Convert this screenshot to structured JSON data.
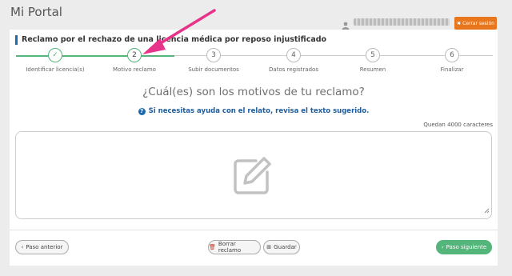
{
  "header": {
    "portal_title": "Mi Portal",
    "logout_label": "Cerrar sesión",
    "accent_color": "#e8761c"
  },
  "card": {
    "title": "Reclamo por el rechazo de una licencia médica por reposo injustificado"
  },
  "steps": [
    {
      "number": "✓",
      "label": "Identificar licencia(s)",
      "state": "done"
    },
    {
      "number": "2",
      "label": "Motivo reclamo",
      "state": "current"
    },
    {
      "number": "3",
      "label": "Subir documentos",
      "state": "pending"
    },
    {
      "number": "4",
      "label": "Datos registrados",
      "state": "pending"
    },
    {
      "number": "5",
      "label": "Resumen",
      "state": "pending"
    },
    {
      "number": "6",
      "label": "Finalizar",
      "state": "pending"
    }
  ],
  "form": {
    "question": "¿Cuál(es) son los motivos de tu reclamo?",
    "help_text": "Si necesitas ayuda con el relato, revisa el texto sugerido.",
    "remaining": "Quedan 4000 caracteres"
  },
  "buttons": {
    "prev": "Paso anterior",
    "delete": "Borrar reclamo",
    "save": "Guardar",
    "next": "Paso siguiente"
  },
  "icons": {
    "user": "user-icon",
    "logout": "close-icon",
    "help": "question-circle-icon",
    "edit": "pencil-icon",
    "prev": "chevron-left-icon",
    "delete": "trash-icon",
    "save": "plus-square-icon",
    "next": "chevron-right-icon",
    "annotation": "arrow-annotation"
  },
  "colors": {
    "primary": "#1e6ab0",
    "success": "#53b57a",
    "annotation": "#e8338a"
  }
}
